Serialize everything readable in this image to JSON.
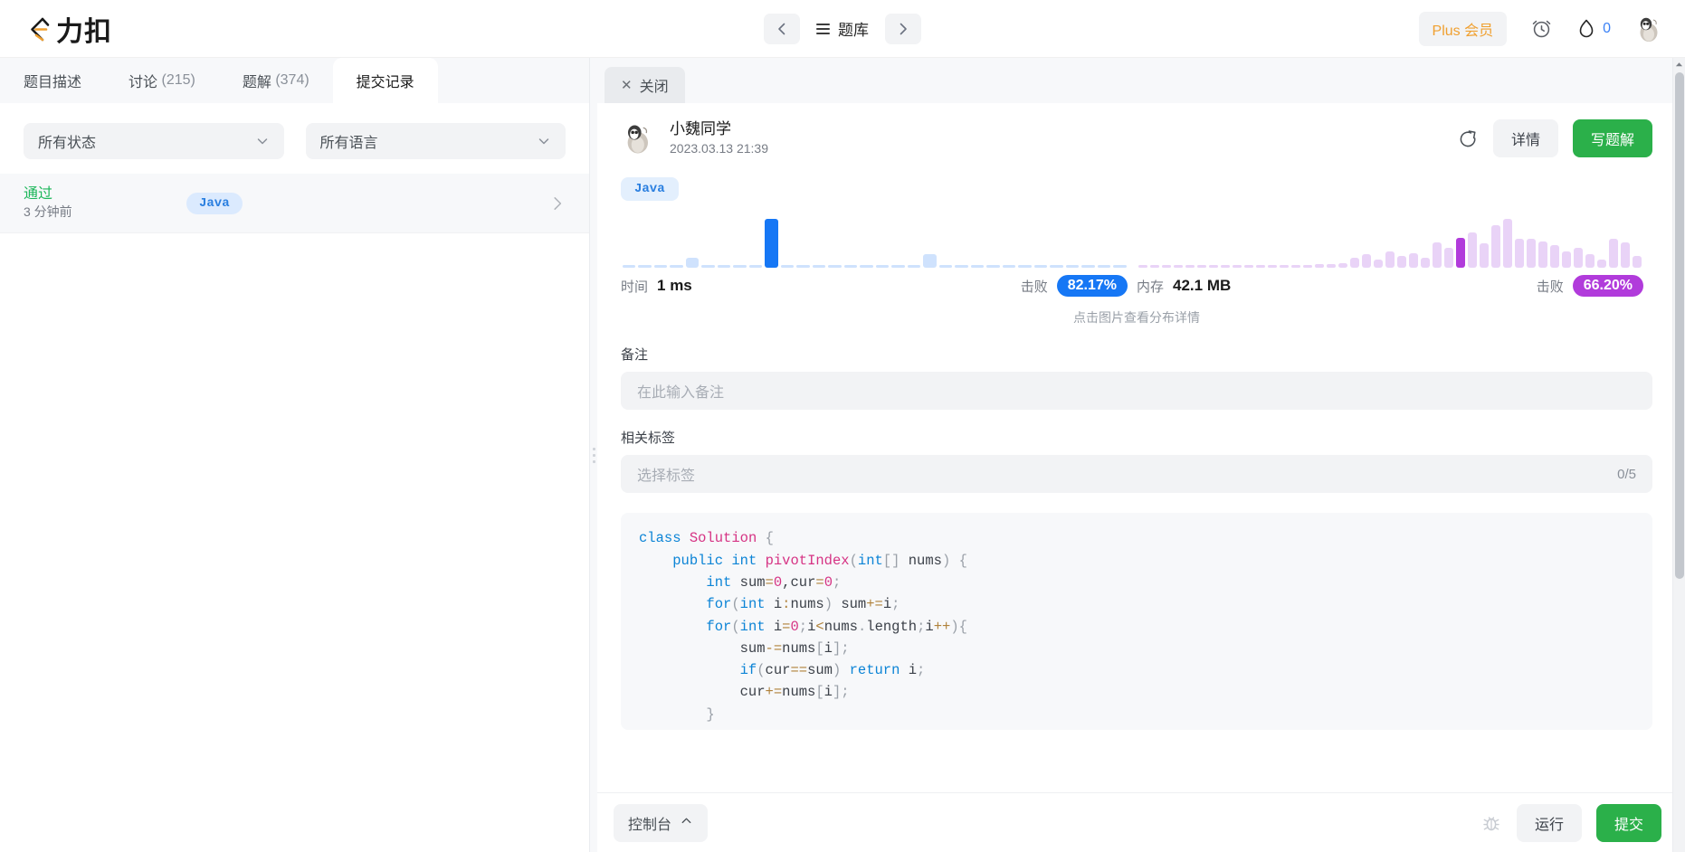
{
  "nav": {
    "logo_text": "力扣",
    "logo_icon": "leetcode-cn-logo-icon",
    "back_icon": "chevron-left-icon",
    "forward_icon": "chevron-right-icon",
    "menu_icon": "hamburger-menu-icon",
    "problemset_label": "题库",
    "plus_label": "Plus 会员",
    "timer_icon": "alarm-clock-icon",
    "streak_icon": "flame-icon",
    "streak_count": "0",
    "avatar_icon": "penguin-avatar-icon"
  },
  "left": {
    "tabs": [
      {
        "label": "题目描述",
        "count": "",
        "active": false
      },
      {
        "label": "讨论",
        "count": "(215)",
        "active": false
      },
      {
        "label": "题解",
        "count": "(374)",
        "active": false
      },
      {
        "label": "提交记录",
        "count": "",
        "active": true
      }
    ],
    "filters": [
      {
        "label": "所有状态",
        "icon": "chevron-down-icon"
      },
      {
        "label": "所有语言",
        "icon": "chevron-down-icon"
      }
    ],
    "submissions": [
      {
        "status": "通过",
        "time": "3 分钟前",
        "language": "Java",
        "chevron": "chevron-right-icon"
      }
    ]
  },
  "right": {
    "close_label": "关闭",
    "close_icon": "close-x-icon",
    "submission": {
      "username": "小魏同学",
      "timestamp": "2023.03.13 21:39",
      "avatar_icon": "penguin-avatar-icon",
      "share_icon": "share-external-icon",
      "detail_label": "详情",
      "write_solution_label": "写题解",
      "language_chip": "Java"
    },
    "chart_hint": "点击图片查看分布详情",
    "note": {
      "label": "备注",
      "placeholder": "在此输入备注",
      "value": ""
    },
    "tags": {
      "label": "相关标签",
      "placeholder": "选择标签",
      "counter": "0/5",
      "value": ""
    },
    "code": {
      "language": "java",
      "lines": [
        "class Solution {",
        "    public int pivotIndex(int[] nums) {",
        "        int sum=0,cur=0;",
        "        for(int i:nums) sum+=i;",
        "        for(int i=0;i<nums.length;i++){",
        "            sum-=nums[i];",
        "            if(cur==sum) return i;",
        "            cur+=nums[i];",
        "        }"
      ]
    }
  },
  "bottom": {
    "console_label": "控制台",
    "console_icon": "chevron-up-icon",
    "debug_icon": "bug-icon",
    "run_label": "运行",
    "submit_label": "提交"
  },
  "colors": {
    "accent_green": "#2bb04a",
    "accent_blue": "#1677f5",
    "accent_purple": "#b13bdb",
    "plus_orange": "#f0a030",
    "pass_green": "#1cb65a",
    "panel_gray": "#f2f3f5"
  },
  "chart_data": [
    {
      "type": "bar",
      "title": "时间分布",
      "metric_label": "时间",
      "metric_value": "1 ms",
      "beat_label": "击败",
      "beat_value": "82.17%",
      "highlight_color": "#1677f5",
      "bar_color": "#cfe2fd",
      "xlabel": "",
      "ylabel": "",
      "categories": [
        "0",
        "1",
        "2",
        "3",
        "4",
        "5",
        "6",
        "7",
        "8",
        "9",
        "10",
        "11",
        "12",
        "13",
        "14",
        "15",
        "16",
        "17",
        "18",
        "19",
        "20",
        "21",
        "22",
        "23",
        "24",
        "25",
        "26",
        "27",
        "28",
        "29",
        "30",
        "31"
      ],
      "values": [
        0,
        0,
        0,
        0,
        9,
        0,
        0,
        0,
        0,
        44,
        0,
        0,
        0,
        0,
        2,
        0,
        0,
        0,
        0,
        12,
        0,
        0,
        0,
        0,
        2,
        0,
        0,
        0,
        0,
        2,
        0,
        0
      ],
      "highlight_index": 9
    },
    {
      "type": "bar",
      "title": "内存分布",
      "metric_label": "内存",
      "metric_value": "42.1 MB",
      "beat_label": "击败",
      "beat_value": "66.20%",
      "highlight_color": "#b13bdb",
      "bar_color": "#e9d3f7",
      "xlabel": "",
      "ylabel": "",
      "categories": [
        "0",
        "1",
        "2",
        "3",
        "4",
        "5",
        "6",
        "7",
        "8",
        "9",
        "10",
        "11",
        "12",
        "13",
        "14",
        "15",
        "16",
        "17",
        "18",
        "19",
        "20",
        "21",
        "22",
        "23",
        "24",
        "25",
        "26",
        "27",
        "28",
        "29",
        "30",
        "31",
        "32",
        "33",
        "34",
        "35",
        "36",
        "37",
        "38",
        "39",
        "40",
        "41",
        "42"
      ],
      "values": [
        2,
        2,
        2,
        2,
        2,
        2,
        2,
        2,
        2,
        2,
        2,
        2,
        2,
        2,
        2,
        3,
        3,
        4,
        9,
        13,
        8,
        15,
        11,
        14,
        9,
        24,
        19,
        28,
        33,
        23,
        40,
        46,
        27,
        27,
        25,
        21,
        15,
        19,
        13,
        8,
        27,
        24,
        11
      ],
      "highlight_index": 27
    }
  ]
}
